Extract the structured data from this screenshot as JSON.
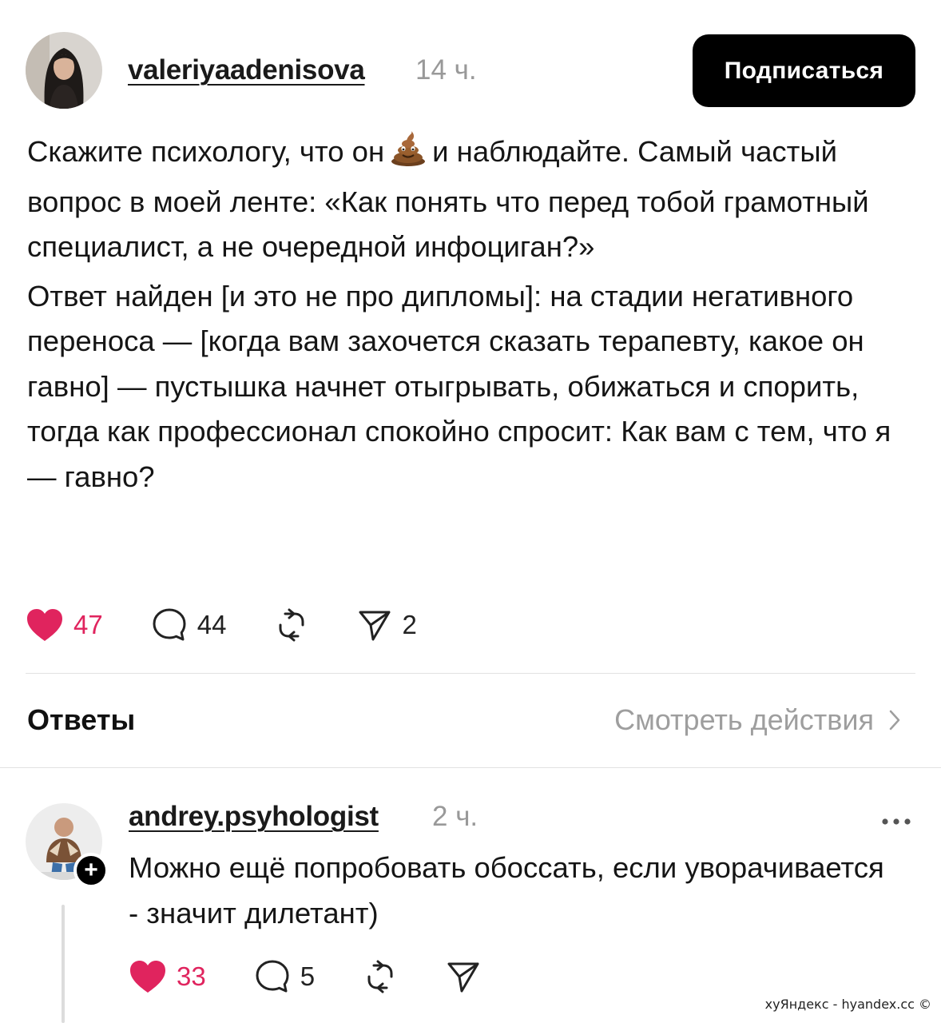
{
  "post": {
    "username": "valeriyaadenisova",
    "time": "14 ч.",
    "follow_label": "Подписаться",
    "text_before_emoji": "Скажите психологу, что он",
    "text_after_emoji": "и наблюдайте. Самый частый вопрос в моей ленте: «Как понять что перед тобой грамотный специалист, а не очередной инфоциган?»",
    "paragraph2": "Ответ найден [и это не про дипломы]: на стадии негативного переноса — [когда вам захочется сказать терапевту, какое он гавно] — пустышка начнет отыгрывать, обижаться и спорить, тогда как профессионал спокойно спросит: Как вам с тем, что я — гавно?",
    "likes": "47",
    "comments": "44",
    "shares": "2"
  },
  "replies_section": {
    "label": "Ответы",
    "view_activity": "Смотреть действия"
  },
  "reply": {
    "username": "andrey.psyhologist",
    "time": "2 ч.",
    "text": "Можно ещё попробовать обоссать, если уворачивается - значит дилетант)",
    "likes": "33",
    "comments": "5"
  },
  "watermark": "хуЯндекс - hyandex.cc ©",
  "colors": {
    "like": "#e0245e",
    "button_bg": "#000000",
    "muted": "#999999"
  }
}
